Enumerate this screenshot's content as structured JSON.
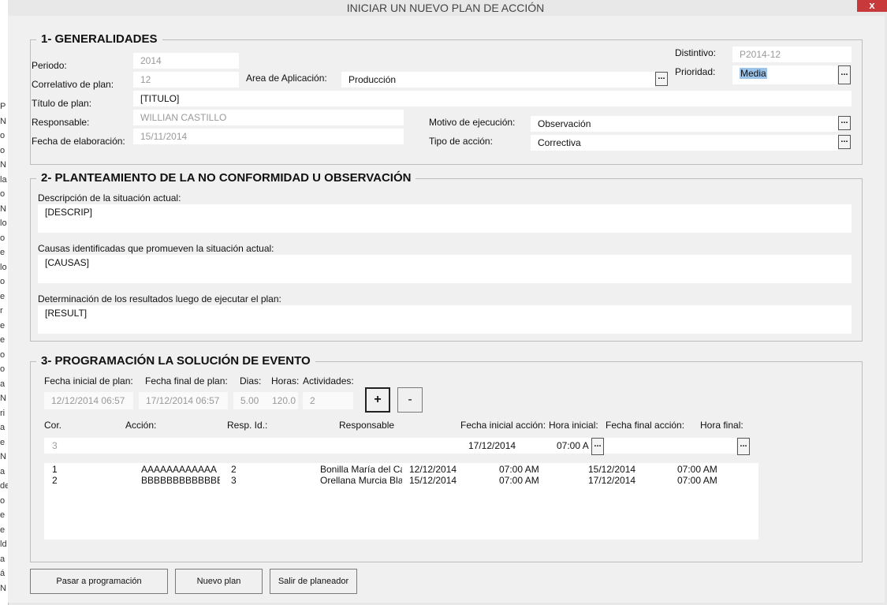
{
  "window": {
    "title": "INICIAR UN NUEVO PLAN DE ACCIÓN",
    "close": "x"
  },
  "left_edge_letters": [
    "P",
    "N",
    "o",
    "o",
    "N",
    "la",
    "o",
    "N",
    "lo",
    "o",
    "e",
    "lo",
    "o",
    "e",
    "r",
    "e",
    "e",
    "o",
    "o",
    "a",
    "N",
    "ri",
    "a",
    "e",
    "N",
    "a",
    "de",
    "o",
    "e",
    "e",
    "ld",
    "a",
    "á",
    "N"
  ],
  "generalidades": {
    "legend": "1- GENERALIDADES",
    "periodo": {
      "label": "Periodo:",
      "value": "2014"
    },
    "correlativo": {
      "label": "Correlativo de plan:",
      "value": "12"
    },
    "area": {
      "label": "Area de Aplicación:",
      "value": "Producción",
      "button": "..."
    },
    "distintivo": {
      "label": "Distintivo:",
      "value": "P2014-12"
    },
    "prioridad": {
      "label": "Prioridad:",
      "value": "Media",
      "button": "..."
    },
    "titulo": {
      "label": "Título de plan:",
      "value": "[TITULO]"
    },
    "responsable": {
      "label": "Responsable:",
      "value": "WILLIAN CASTILLO"
    },
    "motivo": {
      "label": "Motivo de ejecución:",
      "value": "Observación",
      "button": "..."
    },
    "fecha_elab": {
      "label": "Fecha de elaboración:",
      "value": "15/11/2014"
    },
    "tipo_accion": {
      "label": "Tipo de acción:",
      "value": "Correctiva",
      "button": "..."
    }
  },
  "planteamiento": {
    "legend": "2- PLANTEAMIENTO DE LA NO CONFORMIDAD U OBSERVACIÓN",
    "descripcion": {
      "label": "Descripción de la situación actual:",
      "value": "[DESCRIP]"
    },
    "causas": {
      "label": "Causas identificadas que promueven la situación actual:",
      "value": "[CAUSAS]"
    },
    "resultados": {
      "label": "Determinación de los resultados luego de ejecutar el plan:",
      "value": "[RESULT]"
    }
  },
  "programacion": {
    "legend": "3- PROGRAMACIÓN LA SOLUCIÓN DE EVENTO",
    "fecha_inicial": {
      "label": "Fecha inicial de plan:",
      "value": "12/12/2014 06:57"
    },
    "fecha_final": {
      "label": "Fecha final de plan:",
      "value": "17/12/2014 06:57"
    },
    "dias": {
      "label": "Dias:",
      "value": "5.00"
    },
    "horas": {
      "label": "Horas:",
      "value": "120.0"
    },
    "actividades": {
      "label": "Actividades:",
      "value": "2"
    },
    "add_button": "+",
    "remove_button": "-",
    "columns": {
      "cor": "Cor.",
      "accion": "Acción:",
      "resp_id": "Resp. Id.:",
      "responsable": "Responsable",
      "fecha_ini": "Fecha inicial acción:",
      "hora_ini": "Hora inicial:",
      "fecha_fin": "Fecha final acción:",
      "hora_fin": "Hora final:"
    },
    "entry": {
      "cor": "3",
      "fecha_ini": "17/12/2014",
      "hora_ini": "07:00 A",
      "hora_ini_button": "...",
      "hora_fin_button": "..."
    },
    "rows": [
      {
        "cor": "1",
        "accion": "AAAAAAAAAAAA",
        "resp_id": "2",
        "responsable": "Bonilla María del Car",
        "fecha_ini": "12/12/2014",
        "hora_ini": "07:00 AM",
        "fecha_fin": "15/12/2014",
        "hora_fin": "07:00 AM"
      },
      {
        "cor": "2",
        "accion": "BBBBBBBBBBBBBB",
        "resp_id": "3",
        "responsable": "Orellana Murcia Blar",
        "fecha_ini": "15/12/2014",
        "hora_ini": "07:00 AM",
        "fecha_fin": "17/12/2014",
        "hora_fin": "07:00 AM"
      }
    ]
  },
  "footer": {
    "pasar": "Pasar a programación",
    "nuevo": "Nuevo  plan",
    "salir": "Salir de planeador"
  }
}
